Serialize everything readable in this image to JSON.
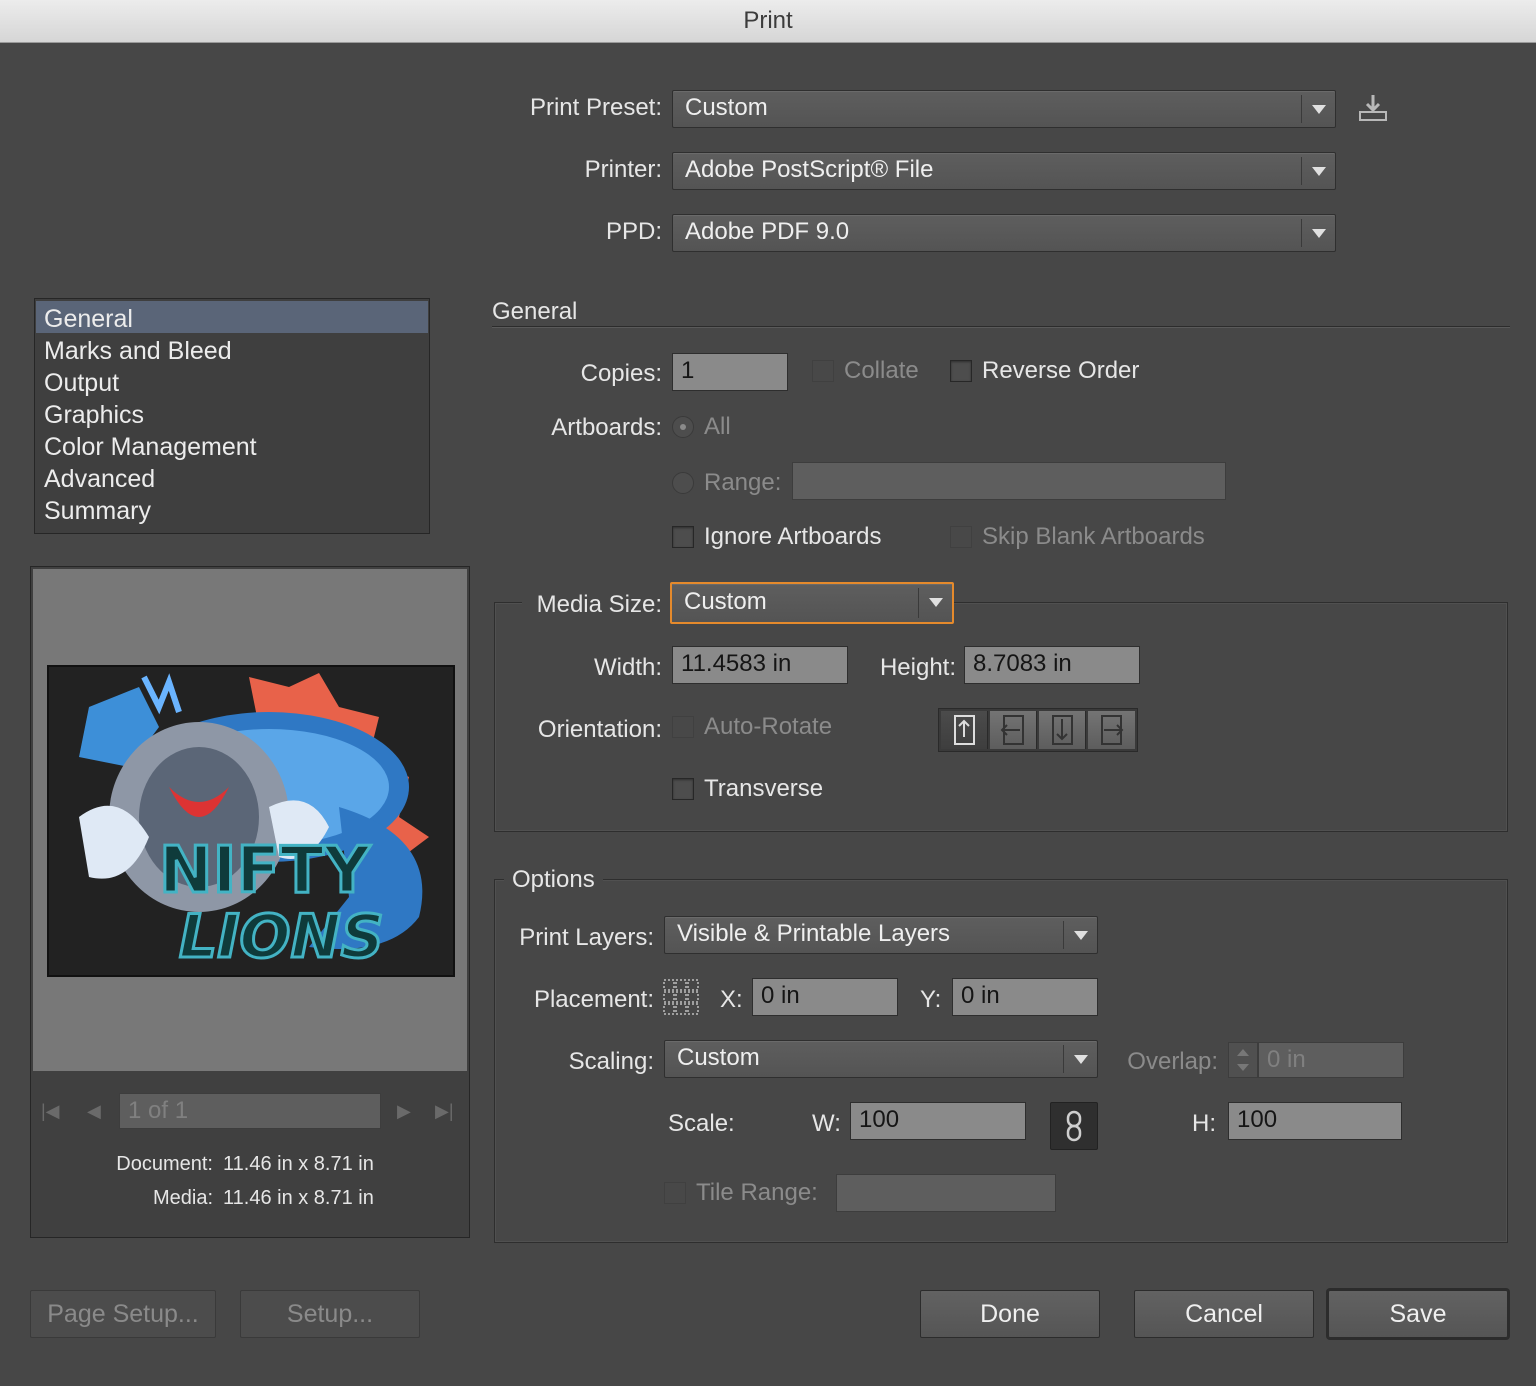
{
  "window": {
    "title": "Print"
  },
  "top": {
    "preset_label": "Print Preset:",
    "preset_value": "Custom",
    "printer_label": "Printer:",
    "printer_value": "Adobe PostScript® File",
    "ppd_label": "PPD:",
    "ppd_value": "Adobe PDF 9.0"
  },
  "sidebar": {
    "items": [
      {
        "label": "General",
        "selected": true
      },
      {
        "label": "Marks and Bleed"
      },
      {
        "label": "Output"
      },
      {
        "label": "Graphics"
      },
      {
        "label": "Color Management"
      },
      {
        "label": "Advanced"
      },
      {
        "label": "Summary"
      }
    ]
  },
  "preview": {
    "page_indicator": "1 of 1",
    "document_label": "Document:",
    "document_value": "11.46 in x 8.71 in",
    "media_label": "Media:",
    "media_value": "11.46 in x 8.71 in",
    "artwork_text_1": "NIFTY",
    "artwork_text_2": "LIONS"
  },
  "general": {
    "heading": "General",
    "copies_label": "Copies:",
    "copies_value": "1",
    "collate_label": "Collate",
    "reverse_order_label": "Reverse Order",
    "artboards_label": "Artboards:",
    "all_label": "All",
    "range_label": "Range:",
    "range_value": "",
    "ignore_artboards_label": "Ignore Artboards",
    "skip_blank_label": "Skip Blank Artboards"
  },
  "media": {
    "size_label": "Media Size:",
    "size_value": "Custom",
    "width_label": "Width:",
    "width_value": "11.4583 in",
    "height_label": "Height:",
    "height_value": "8.7083 in",
    "orientation_label": "Orientation:",
    "auto_rotate_label": "Auto-Rotate",
    "transverse_label": "Transverse"
  },
  "options": {
    "heading": "Options",
    "print_layers_label": "Print Layers:",
    "print_layers_value": "Visible & Printable Layers",
    "placement_label": "Placement:",
    "x_label": "X:",
    "x_value": "0 in",
    "y_label": "Y:",
    "y_value": "0 in",
    "scaling_label": "Scaling:",
    "scaling_value": "Custom",
    "overlap_label": "Overlap:",
    "overlap_value": "0 in",
    "scale_label": "Scale:",
    "w_label": "W:",
    "w_value": "100",
    "h_label": "H:",
    "h_value": "100",
    "tile_range_label": "Tile Range:",
    "tile_range_value": ""
  },
  "footer": {
    "page_setup_label": "Page Setup...",
    "setup_label": "Setup...",
    "done_label": "Done",
    "cancel_label": "Cancel",
    "save_label": "Save"
  },
  "colors": {
    "accent_focus": "#e58a2c",
    "selection": "#5a6578"
  }
}
